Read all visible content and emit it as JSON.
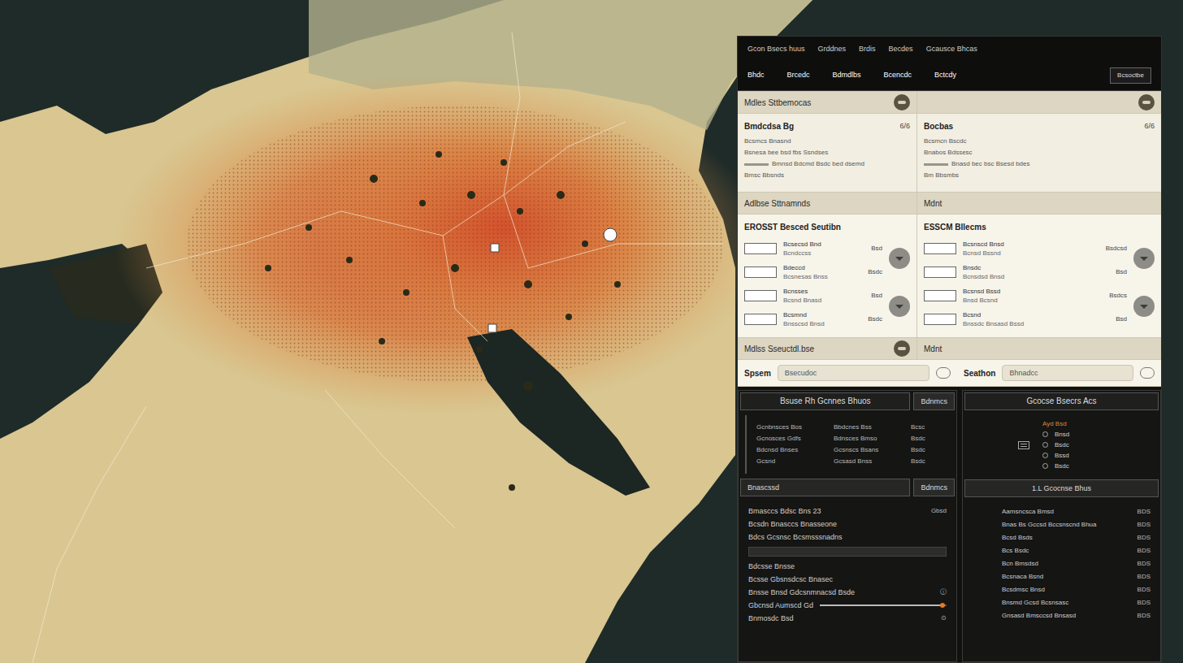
{
  "header": {
    "links": [
      "Gcon Bsecs huus",
      "Grddnes",
      "Brdis",
      "Becdes",
      "Gcausce Bhcas"
    ],
    "sublinks": [
      "Bhdc",
      "Brcedc",
      "Bdmdlbs",
      "Bcencdc",
      "Bctcdy"
    ],
    "button": "Bcsoctbe"
  },
  "overview": {
    "title": "Mdles Sttbemocas",
    "cards": [
      {
        "title": "Bmdcdsa Bg",
        "count": "6/6",
        "lines": [
          "Bcsmcs Bnasnd",
          "Bsnesa bee bsd fbs Ssndses",
          "Bmnsd Bdcmd Bsdc bed dsemd",
          "Bmsc Bbsnds"
        ]
      },
      {
        "title": "Bocbas",
        "count": "6/6",
        "lines": [
          "Bcsmcn Bscdc",
          "Bnabos Bdssesc",
          "Bnasd bec bsc Bsesd bdes",
          "Bm Bbsmbs"
        ]
      }
    ]
  },
  "alerts": {
    "title": "Adlbse Sttnamnds",
    "title_right": "Mdnt",
    "cards": [
      {
        "title": "EROSST Besced Seutibn",
        "rows": [
          {
            "label": "Bcsecsd Bnd",
            "sub": "Bcndccss",
            "value": "Bsd"
          },
          {
            "label": "Bdeccd",
            "sub": "Bcsnesas Bnss",
            "value": "Bsdc"
          },
          {
            "label": "Bcnsses",
            "sub": "Bcsnd Bnasd",
            "value": "Bsd"
          },
          {
            "label": "Bcsmnd",
            "sub": "Bnsscsd Bnsd",
            "value": "Bsdc"
          }
        ]
      },
      {
        "title": "ESSCM Bllecms",
        "rows": [
          {
            "label": "Bcsnscd Bnsd",
            "sub": "Bcnsd Bssnd",
            "value": "Bsdcsd"
          },
          {
            "label": "Bnsdc",
            "sub": "Bcnsdsd Bnsd",
            "value": "Bsd"
          },
          {
            "label": "Bcsnsd Bssd",
            "sub": "Bnsd Bcsnd",
            "value": "Bsdcs"
          },
          {
            "label": "Bcsnd",
            "sub": "Bnssdc Bnsasd Bssd",
            "value": "Bsd"
          }
        ]
      }
    ],
    "footer": "Mdlss Sseuctdl.bse",
    "footer_right": "Mdnt"
  },
  "search": [
    {
      "label": "Spsem",
      "placeholder": "Bsecudoc"
    },
    {
      "label": "Seathon",
      "placeholder": "Bhnadcc"
    }
  ],
  "results": {
    "title": "Bsuse Rh Gcnnes Bhuos",
    "button": "Bdnmcs",
    "table": [
      [
        "Gcnbnsces Bos",
        "Bbdcnes Bss",
        "Bcsc"
      ],
      [
        "Gcnosces Gdfs",
        "Bdnsces Bmso",
        "Bsdc"
      ],
      [
        "Bdcnsd Bnses",
        "Gcsnscs Bsans",
        "Bsdc"
      ],
      [
        "Gcsnd",
        "Gcsasd Bnss",
        "Bsdc"
      ]
    ],
    "subtitle": "Bnascssd",
    "subtitle_button": "Bdnmcs",
    "items": [
      {
        "kind": "text",
        "label": "Bmasccs Bdsc Bns 23",
        "value": "Gbsd"
      },
      {
        "kind": "text",
        "label": "Bcsdn Bnasccs Bnasseone",
        "value": ""
      },
      {
        "kind": "text",
        "label": "Bdcs Gcsnsc Bcsmsssnadns",
        "value": ""
      },
      {
        "kind": "field",
        "label": "",
        "value": ""
      },
      {
        "kind": "text",
        "label": "Bdcsse Bnsse",
        "value": ""
      },
      {
        "kind": "text",
        "label": "Bcsse Gbsnsdcsc Bnasec",
        "value": ""
      },
      {
        "kind": "text",
        "label": "Bnsse Bnsd Gdcsnmnacsd Bsde",
        "value": "ⓘ"
      },
      {
        "kind": "slider",
        "label": "Gbcnsd Aumscd Gd",
        "level": 0.97
      },
      {
        "kind": "text",
        "label": "Bnmosdc Bsd",
        "value": "⊙"
      }
    ]
  },
  "sources": {
    "title": "Gcocse Bsecrs Acs",
    "legend": {
      "heading": "Ayd Bsd",
      "options": [
        {
          "label": "Bnsd",
          "selected": false
        },
        {
          "label": "Bsdc",
          "selected": false
        },
        {
          "label": "Bssd",
          "selected": false
        },
        {
          "label": "Bsdc",
          "selected": false
        }
      ]
    },
    "list_title": "1.L Gcocnse Bhus",
    "list": [
      {
        "label": "Aamsncsca Bmsd",
        "value": "BDS"
      },
      {
        "label": "Bnas Bs Gccsd Bccsnscnd Bhua",
        "value": "BDS"
      },
      {
        "label": "Bcsd Bsds",
        "value": "BDS"
      },
      {
        "label": "Bcs Bsdc",
        "value": "BDS"
      },
      {
        "label": "Bcn Bmsdsd",
        "value": "BDS"
      },
      {
        "label": "Bcsnaca Bsnd",
        "value": "BDS"
      },
      {
        "label": "Bcsdmsc Bnsd",
        "value": "BDS"
      },
      {
        "label": "Bnsmd Gcsd Bcsnsasc",
        "value": "BDS"
      },
      {
        "label": "Gnsasd Bmsccsd Bnsasd",
        "value": "BDS"
      }
    ]
  }
}
